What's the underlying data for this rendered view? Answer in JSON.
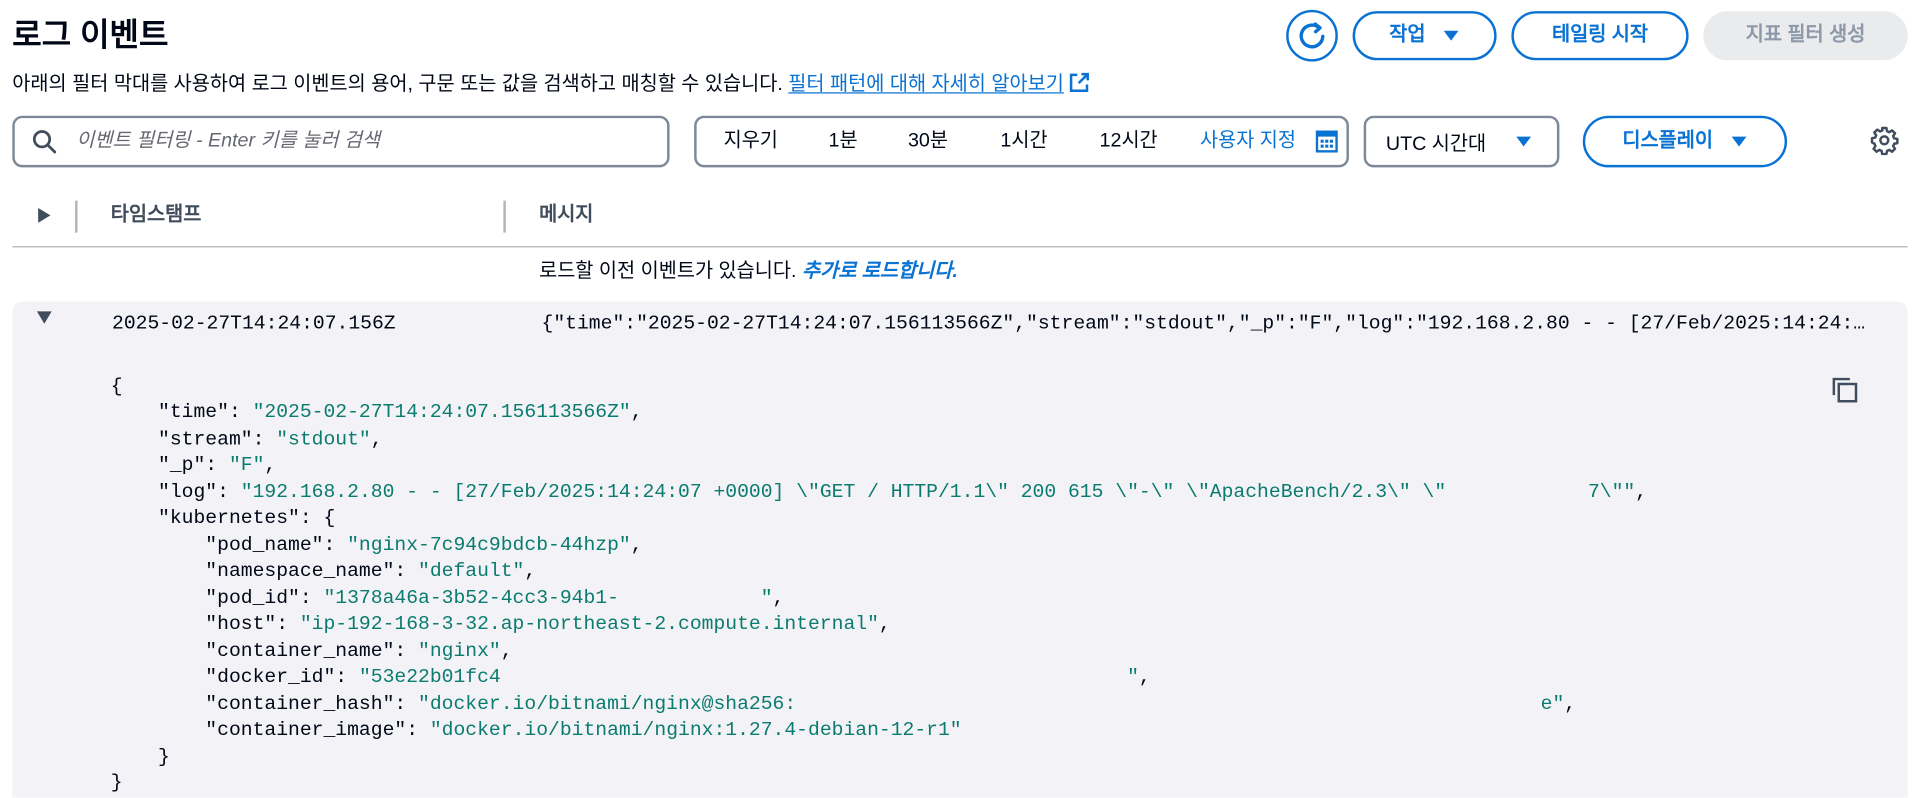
{
  "header": {
    "title": "로그 이벤트",
    "actions_label": "작업",
    "tail_label": "테일링 시작",
    "metric_filter_label": "지표 필터 생성"
  },
  "description": {
    "text": "아래의 필터 막대를 사용하여 로그 이벤트의 용어, 구문 또는 값을 검색하고 매칭할 수 있습니다.",
    "link_text": "필터 패턴에 대해 자세히 알아보기"
  },
  "filter": {
    "placeholder": "이벤트 필터링 - Enter 키를 눌러 검색",
    "value": ""
  },
  "time_range": {
    "options": [
      "지우기",
      "1분",
      "30분",
      "1시간",
      "12시간"
    ],
    "custom_label": "사용자 지정"
  },
  "timezone": {
    "selected": "UTC 시간대"
  },
  "display": {
    "label": "디스플레이"
  },
  "table": {
    "columns": [
      "타임스탬프",
      "메시지"
    ],
    "load_more_text": "로드할 이전 이벤트가 있습니다.",
    "load_more_link": "추가로 로드합니다.",
    "events": [
      {
        "timestamp": "2025-02-27T14:24:07.156Z",
        "message": "{\"time\":\"2025-02-27T14:24:07.156113566Z\",\"stream\":\"stdout\",\"_p\":\"F\",\"log\":\"192.168.2.80 - - [27/Feb/2025:14:24:…",
        "detail": {
          "lines": [
            {
              "key": "",
              "value": "",
              "punct": "{"
            },
            {
              "key": "\"time\": ",
              "value": "\"2025-02-27T14:24:07.156113566Z\"",
              "punct": ","
            },
            {
              "key": "\"stream\": ",
              "value": "\"stdout\"",
              "punct": ","
            },
            {
              "key": "\"_p\": ",
              "value": "\"F\"",
              "punct": ","
            },
            {
              "key": "\"log\": ",
              "value": "\"192.168.2.80 - - [27/Feb/2025:14:24:07 +0000] \\\"GET / HTTP/1.1\\\" 200 615 \\\"-\\\" \\\"ApacheBench/2.3\\\" \\\"            7\\\"\"",
              "punct": ","
            },
            {
              "key": "\"kubernetes\": ",
              "value": "",
              "punct": "{"
            },
            {
              "key": "\"pod_name\": ",
              "value": "\"nginx-7c94c9bdcb-44hzp\"",
              "punct": ","
            },
            {
              "key": "\"namespace_name\": ",
              "value": "\"default\"",
              "punct": ","
            },
            {
              "key": "\"pod_id\": ",
              "value": "\"1378a46a-3b52-4cc3-94b1-            \"",
              "punct": ","
            },
            {
              "key": "\"host\": ",
              "value": "\"ip-192-168-3-32.ap-northeast-2.compute.internal\"",
              "punct": ","
            },
            {
              "key": "\"container_name\": ",
              "value": "\"nginx\"",
              "punct": ","
            },
            {
              "key": "\"docker_id\": ",
              "value": "\"53e22b01fc4                                                     \"",
              "punct": ","
            },
            {
              "key": "\"container_hash\": ",
              "value": "\"docker.io/bitnami/nginx@sha256:                                                               e\"",
              "punct": ","
            },
            {
              "key": "\"container_image\": ",
              "value": "\"docker.io/bitnami/nginx:1.27.4-debian-12-r1\"",
              "punct": ""
            },
            {
              "key": "",
              "value": "",
              "punct": "}"
            },
            {
              "key": "",
              "value": "",
              "punct": "}"
            }
          ]
        }
      }
    ]
  },
  "icons": {
    "refresh": "refresh-icon",
    "dropdown": "caret-down-icon",
    "external_link": "external-link-icon",
    "search": "search-icon",
    "calendar": "calendar-icon",
    "settings": "gear-icon",
    "expand_all": "caret-right-icon",
    "collapse_row": "caret-down-icon",
    "copy": "copy-icon"
  },
  "colors": {
    "accent": "#0972d3",
    "text": "#000716",
    "muted": "#414d5c",
    "field_border": "#7d8998",
    "disabled_bg": "#e9ebed",
    "disabled_text": "#8d99a8",
    "expanded_row_bg": "#f3f3f7",
    "json_value": "#0b7b6f"
  }
}
